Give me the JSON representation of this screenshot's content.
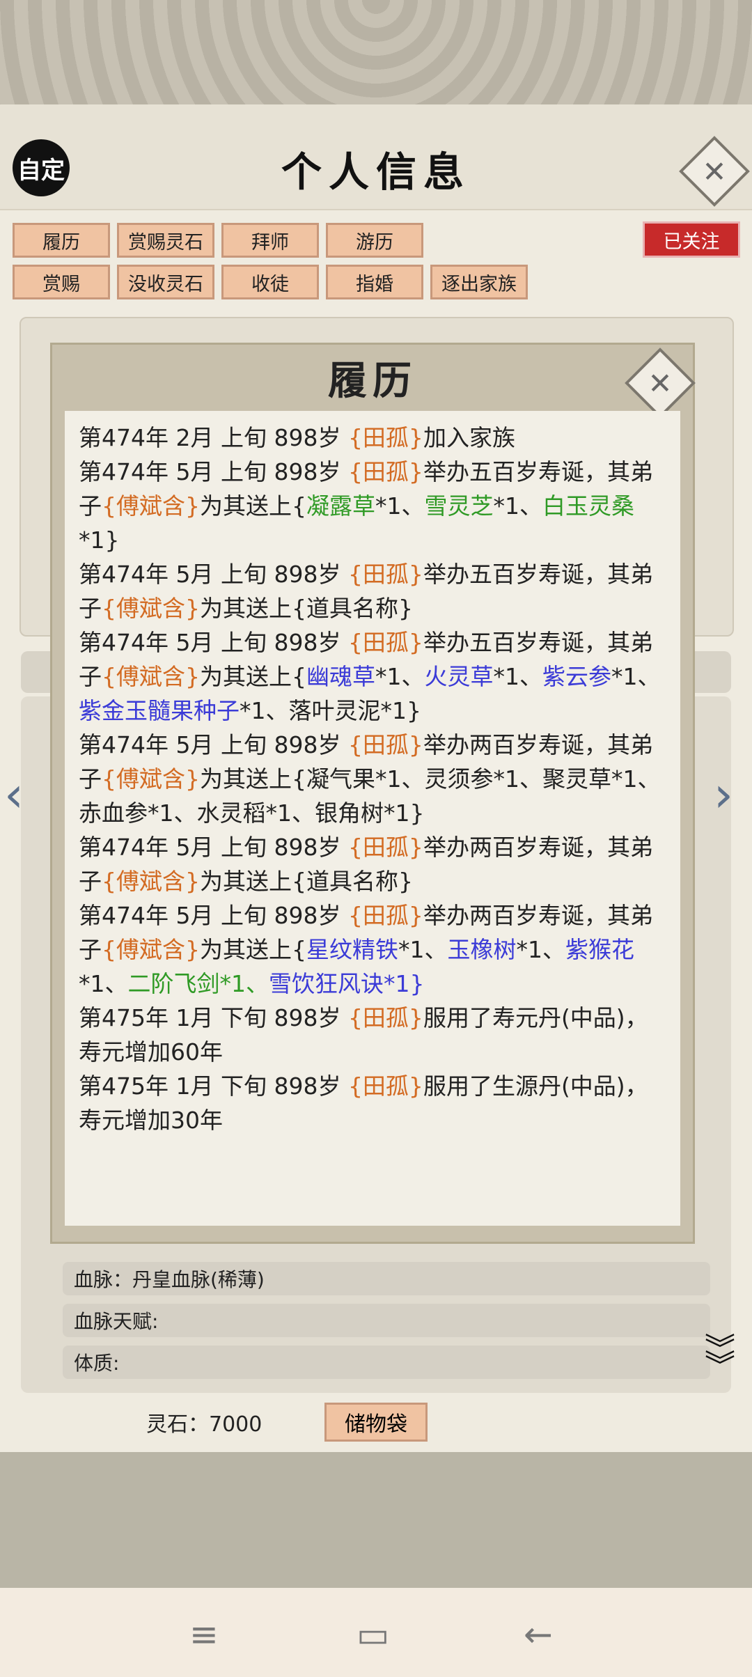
{
  "header": {
    "auto_label": "自定",
    "title": "个人信息"
  },
  "menu": {
    "row1": [
      "履历",
      "赏赐灵石",
      "拜师",
      "游历"
    ],
    "row2": [
      "赏赐",
      "没收灵石",
      "收徒",
      "指婚",
      "逐出家族"
    ],
    "follow_label": "已关注"
  },
  "modal": {
    "title": "履历",
    "entries": [
      [
        {
          "t": "第474年 2月 上旬  898岁  "
        },
        {
          "t": "{田孤}",
          "c": "o"
        },
        {
          "t": "加入家族"
        }
      ],
      [
        {
          "t": "第474年 5月 上旬 898岁 "
        },
        {
          "t": "{田孤}",
          "c": "o"
        },
        {
          "t": "举办五百岁寿诞，其弟子"
        },
        {
          "t": "{傅斌含}",
          "c": "o"
        },
        {
          "t": "为其送上{"
        },
        {
          "t": "凝露草",
          "c": "g"
        },
        {
          "t": "*1、"
        },
        {
          "t": "雪灵芝",
          "c": "g"
        },
        {
          "t": "*1、"
        },
        {
          "t": "白玉灵桑",
          "c": "g"
        },
        {
          "t": "*1}"
        }
      ],
      [
        {
          "t": "第474年 5月 上旬 898岁 "
        },
        {
          "t": "{田孤}",
          "c": "o"
        },
        {
          "t": "举办五百岁寿诞，其弟子"
        },
        {
          "t": "{傅斌含}",
          "c": "o"
        },
        {
          "t": "为其送上{道具名称}"
        }
      ],
      [
        {
          "t": "第474年 5月 上旬 898岁 "
        },
        {
          "t": "{田孤}",
          "c": "o"
        },
        {
          "t": "举办五百岁寿诞，其弟子"
        },
        {
          "t": "{傅斌含}",
          "c": "o"
        },
        {
          "t": "为其送上{"
        },
        {
          "t": "幽魂草",
          "c": "b"
        },
        {
          "t": "*1、"
        },
        {
          "t": "火灵草",
          "c": "b"
        },
        {
          "t": "*1、"
        },
        {
          "t": "紫云参",
          "c": "b"
        },
        {
          "t": "*1、"
        },
        {
          "t": "紫金玉髓果种子",
          "c": "b"
        },
        {
          "t": "*1、落叶灵泥*1}"
        }
      ],
      [
        {
          "t": "第474年 5月 上旬 898岁 "
        },
        {
          "t": "{田孤}",
          "c": "o"
        },
        {
          "t": "举办两百岁寿诞，其弟子"
        },
        {
          "t": "{傅斌含}",
          "c": "o"
        },
        {
          "t": "为其送上{凝气果*1、灵须参*1、聚灵草*1、赤血参*1、水灵稻*1、银角树*1}"
        }
      ],
      [
        {
          "t": "第474年 5月 上旬 898岁 "
        },
        {
          "t": "{田孤}",
          "c": "o"
        },
        {
          "t": "举办两百岁寿诞，其弟子"
        },
        {
          "t": "{傅斌含}",
          "c": "o"
        },
        {
          "t": "为其送上{道具名称}"
        }
      ],
      [
        {
          "t": "第474年 5月 上旬 898岁 "
        },
        {
          "t": "{田孤}",
          "c": "o"
        },
        {
          "t": "举办两百岁寿诞，其弟子"
        },
        {
          "t": "{傅斌含}",
          "c": "o"
        },
        {
          "t": "为其送上{"
        },
        {
          "t": "星纹精铁",
          "c": "b"
        },
        {
          "t": "*1、"
        },
        {
          "t": "玉橡树",
          "c": "b"
        },
        {
          "t": "*1、"
        },
        {
          "t": "紫猴花",
          "c": "b"
        },
        {
          "t": "*1、"
        },
        {
          "t": "二阶飞剑*1、",
          "c": "g"
        },
        {
          "t": "雪饮狂风诀*1}",
          "c": "b"
        }
      ],
      [
        {
          "t": "第475年 1月 下旬  898岁  "
        },
        {
          "t": "{田孤}",
          "c": "o"
        },
        {
          "t": "服用了寿元丹(中品)，寿元增加60年"
        }
      ],
      [
        {
          "t": "第475年 1月 下旬  898岁  "
        },
        {
          "t": "{田孤}",
          "c": "o"
        },
        {
          "t": "服用了生源丹(中品)，寿元增加30年"
        }
      ]
    ]
  },
  "details": {
    "bloodline": "血脉：丹皇血脉(稀薄)",
    "bloodline_talent": "血脉天赋:",
    "physique": "体质:"
  },
  "footer": {
    "lingshi": "灵石：7000",
    "storage_label": "储物袋"
  }
}
